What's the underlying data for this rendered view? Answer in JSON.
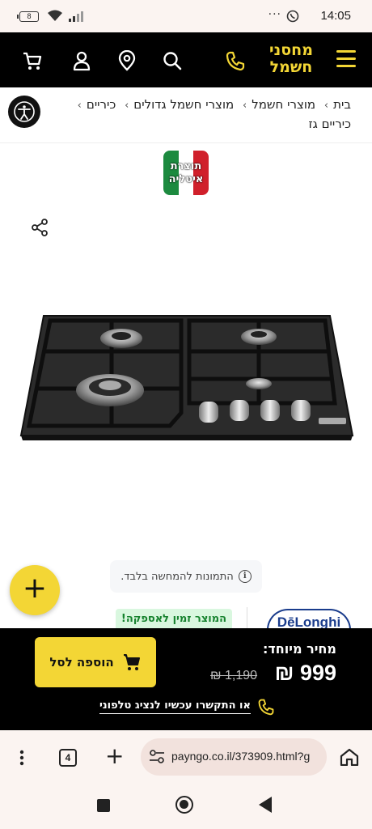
{
  "status_bar": {
    "time": "14:05",
    "battery": "8",
    "more": "···"
  },
  "header": {
    "logo_line1": "מחסני",
    "logo_line2": "חשמל"
  },
  "breadcrumb": {
    "items": [
      "בית",
      "מוצרי חשמל",
      "מוצרי חשמל גדולים",
      "כיריים",
      "כיריים גז"
    ]
  },
  "badge": {
    "line1": "תוצרת",
    "line2": "איטליה"
  },
  "disclaimer": {
    "text": "התמונות להמחשה בלבד.",
    "info_icon": "i"
  },
  "fab": {
    "label": "+"
  },
  "product": {
    "stock_badge": "המוצר זמין לאספקה!",
    "brand": "DēLonghi"
  },
  "buy_bar": {
    "special_price_label": "מחיר מיוחד:",
    "price": "999 ₪",
    "old_price": "1,190 ₪",
    "add_to_cart": "הוספה לסל",
    "call_text": "או התקשרו עכשיו לנציג טלפוני"
  },
  "browser": {
    "url": "payngo.co.il/373909.html?g",
    "tab_count": "4",
    "new_tab": "+"
  },
  "colors": {
    "accent_yellow": "#f3d635",
    "header_bg": "#000000",
    "in_stock_green": "#16822e"
  },
  "icons": [
    "hamburger-icon",
    "phone-icon",
    "search-icon",
    "location-icon",
    "user-icon",
    "cart-icon",
    "accessibility-icon",
    "share-icon",
    "info-icon",
    "home-icon"
  ]
}
